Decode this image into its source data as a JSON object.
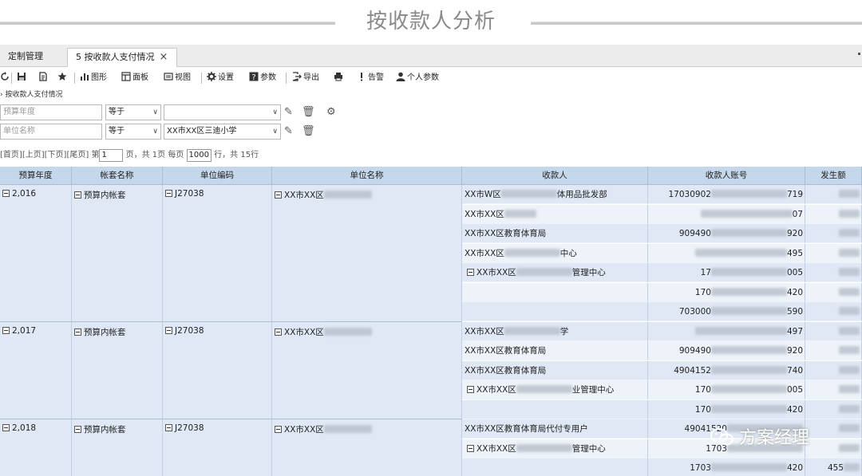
{
  "banner": {
    "title": "按收款人分析"
  },
  "tabs": [
    {
      "label": "定制管理"
    },
    {
      "label": "5 按收款人支付情况"
    }
  ],
  "tab_close": "×",
  "toolbar": {
    "chart": "图形",
    "panel": "面板",
    "view": "视图",
    "settings": "设置",
    "params": "参数",
    "export": "导出",
    "alert": "告警",
    "personal_params": "个人参数"
  },
  "breadcrumb": "按收款人支付情况",
  "filters": [
    {
      "field": "预算年度",
      "op": "等于",
      "value": ""
    },
    {
      "field": "单位名称",
      "op": "等于",
      "value": "XX市XX区三迪小学"
    }
  ],
  "pager": {
    "first": "[首页]",
    "prev": "[上页]",
    "next": "[下页]",
    "last": "[尾页]",
    "page_prefix": "第",
    "page": "1",
    "page_suffix": "页，共 1页 每页",
    "per_page": "1000",
    "rows_suffix": "行，共 15行"
  },
  "columns": [
    "预算年度",
    "帐套名称",
    "单位编码",
    "单位名称",
    "收款人",
    "收款人账号",
    "发生额"
  ],
  "groups": [
    {
      "year": "2,016",
      "account_set": "预算内帐套",
      "unit_code": "J27038",
      "unit_name": "XX市XX区",
      "rows": [
        {
          "payee": "XX市W区",
          "payee_tail": "体用品批发部",
          "acct_head": "17030902",
          "acct_tail": "719"
        },
        {
          "payee": "XX市XX区",
          "payee_tail": "",
          "acct_head": "",
          "acct_tail": "07"
        },
        {
          "payee": "XX市XX区教育体育局",
          "payee_tail": "",
          "acct_head": "909490",
          "acct_tail": "920"
        },
        {
          "payee": "XX市XX区",
          "payee_tail": "中心",
          "acct_head": "",
          "acct_tail": "495"
        },
        {
          "payee": "XX市XX区",
          "payee_tail": "管理中心",
          "sub": true,
          "acct_head": "17",
          "acct_tail": "005"
        },
        {
          "payee": "",
          "payee_tail": "",
          "acct_head": "170",
          "acct_tail": "420"
        },
        {
          "payee": "",
          "payee_tail": "",
          "acct_head": "703000",
          "acct_tail": "590"
        }
      ]
    },
    {
      "year": "2,017",
      "account_set": "预算内帐套",
      "unit_code": "J27038",
      "unit_name": "XX市XX区",
      "rows": [
        {
          "payee": "XX市XX区",
          "payee_tail": "学",
          "acct_head": "",
          "acct_tail": "497"
        },
        {
          "payee": "XX市XX区教育体育局",
          "payee_tail": "",
          "acct_head": "909490",
          "acct_tail": "920"
        },
        {
          "payee": "XX市XX区教育体育局",
          "payee_tail": "",
          "acct_head": "4904152",
          "acct_tail": "740"
        },
        {
          "payee": "XX市XX区",
          "payee_tail": "业管理中心",
          "sub": true,
          "acct_head": "170",
          "acct_tail": "005"
        },
        {
          "payee": "",
          "payee_tail": "",
          "acct_head": "170",
          "acct_tail": "420"
        }
      ]
    },
    {
      "year": "2,018",
      "account_set": "预算内帐套",
      "unit_code": "J27038",
      "unit_name": "XX市XX区",
      "rows": [
        {
          "payee": "XX市XX区教育体育局代付专用户",
          "payee_tail": "",
          "acct_head": "49041520",
          "acct_tail": ""
        },
        {
          "payee": "XX市XX区",
          "payee_tail": "管理中心",
          "sub": true,
          "acct_head": "1703",
          "acct_tail": ""
        },
        {
          "payee": "",
          "payee_tail": "",
          "acct_head": "1703",
          "acct_tail": "420",
          "amount": "455"
        }
      ]
    }
  ],
  "watermark": "方案经理"
}
